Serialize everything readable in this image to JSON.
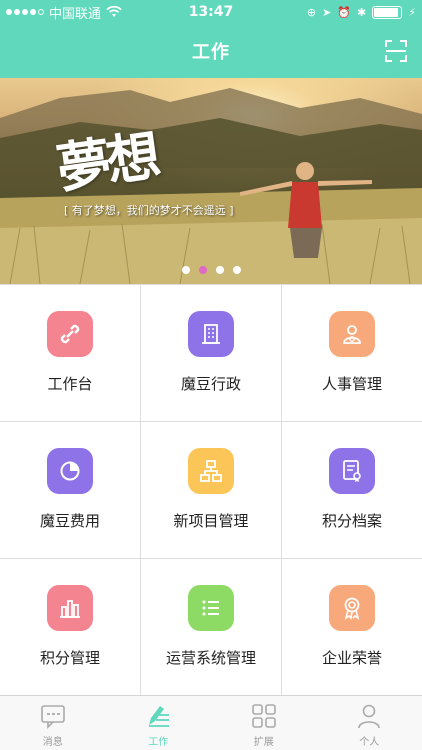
{
  "status_bar": {
    "carrier": "中国联通",
    "time": "13:47",
    "battery_level": 0.9
  },
  "nav": {
    "title": "工作",
    "scan_icon": "scan-icon"
  },
  "banner": {
    "calligraphy": "夢想",
    "tagline": "[ 有了梦想，我们的梦才不会遥远 ]",
    "page_count": 4,
    "active_page": 1
  },
  "grid": {
    "items": [
      {
        "label": "工作台",
        "icon": "link-icon",
        "color": "#f4848f"
      },
      {
        "label": "魔豆行政",
        "icon": "building-icon",
        "color": "#8e73e8"
      },
      {
        "label": "人事管理",
        "icon": "person-icon",
        "color": "#f8a97c"
      },
      {
        "label": "魔豆费用",
        "icon": "pie-chart-icon",
        "color": "#8e73e8"
      },
      {
        "label": "新项目管理",
        "icon": "org-chart-icon",
        "color": "#fcc557"
      },
      {
        "label": "积分档案",
        "icon": "certificate-icon",
        "color": "#8e73e8"
      },
      {
        "label": "积分管理",
        "icon": "bar-chart-icon",
        "color": "#f4848f"
      },
      {
        "label": "运营系统管理",
        "icon": "list-icon",
        "color": "#8ddb64"
      },
      {
        "label": "企业荣誉",
        "icon": "medal-icon",
        "color": "#f8a97c"
      }
    ]
  },
  "tabbar": {
    "tabs": [
      {
        "label": "消息",
        "icon": "message-icon"
      },
      {
        "label": "工作",
        "icon": "pen-icon",
        "active": true
      },
      {
        "label": "扩展",
        "icon": "apps-icon"
      },
      {
        "label": "个人",
        "icon": "user-icon"
      }
    ]
  },
  "colors": {
    "accent": "#5fd8bc",
    "pager_active": "#e069c5"
  }
}
